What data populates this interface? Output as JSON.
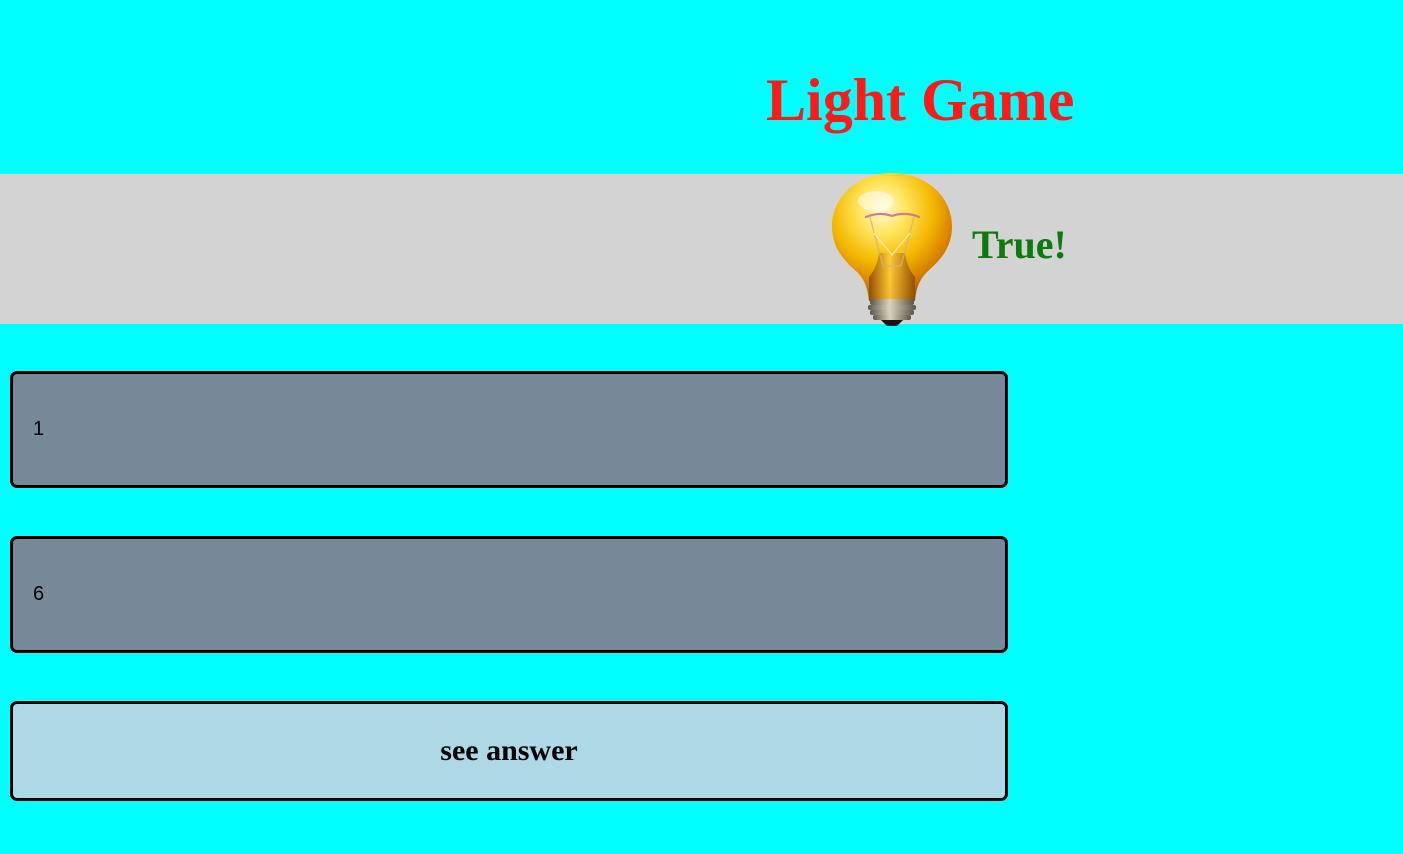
{
  "page": {
    "title": "Light Game",
    "result": "True!"
  },
  "inputs": [
    {
      "value": "1"
    },
    {
      "value": "6"
    }
  ],
  "buttons": {
    "see_answer": "see answer"
  },
  "icons": {
    "bulb": "light-bulb-icon"
  },
  "colors": {
    "background": "#00ffff",
    "title": "#ff1a1a",
    "status_bar": "#d3d3d3",
    "result": "#0c7a0c",
    "field": "#778899",
    "button": "#add8e6"
  }
}
